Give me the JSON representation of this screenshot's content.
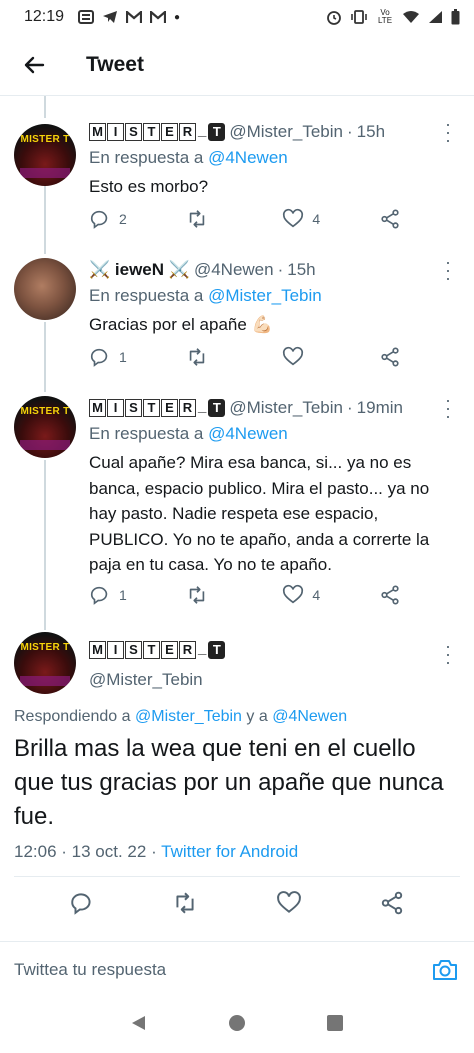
{
  "status_bar": {
    "time": "12:19",
    "left_icons": [
      "notes-icon",
      "telegram-icon",
      "gmail-icon",
      "gmail-icon",
      "dot-icon"
    ],
    "right_icons": [
      "alarm-icon",
      "vibrate-icon",
      "volte-icon",
      "wifi-icon",
      "signal-icon",
      "battery-icon"
    ],
    "volte_label": "Vo LTE"
  },
  "header": {
    "title": "Tweet"
  },
  "tweets": [
    {
      "name_letters": [
        "M",
        "I",
        "S",
        "T",
        "E",
        "R"
      ],
      "name_underscore": "_",
      "name_t": "T",
      "handle": "@Mister_Tebin",
      "time_ago": "15h",
      "reply_prefix": "En respuesta a",
      "reply_to": "@4Newen",
      "text": "Esto es morbo?",
      "replies": "2",
      "retweets": "",
      "likes": "4",
      "avatar_text": "MISTER T"
    },
    {
      "name_prefix": "⚔️",
      "name": "ieweN",
      "name_suffix": "⚔️",
      "handle": "@4Newen",
      "time_ago": "15h",
      "reply_prefix": "En respuesta a",
      "reply_to": "@Mister_Tebin",
      "text": "Gracias por el apañe 💪🏻",
      "replies": "1",
      "retweets": "",
      "likes": ""
    },
    {
      "name_letters": [
        "M",
        "I",
        "S",
        "T",
        "E",
        "R"
      ],
      "name_underscore": "_",
      "name_t": "T",
      "handle": "@Mister_Tebin",
      "time_ago": "19min",
      "reply_prefix": "En respuesta a",
      "reply_to": "@4Newen",
      "text": "Cual apañe? Mira esa banca, si... ya no es banca, espacio publico. Mira el pasto... ya no hay pasto. Nadie respeta ese espacio, PUBLICO. Yo no te apaño, anda a correrte la paja en tu casa. Yo no te apaño.",
      "replies": "1",
      "retweets": "",
      "likes": "4",
      "avatar_text": "MISTER T"
    }
  ],
  "main_tweet": {
    "name_letters": [
      "M",
      "I",
      "S",
      "T",
      "E",
      "R"
    ],
    "name_underscore": "_",
    "name_t": "T",
    "handle": "@Mister_Tebin",
    "avatar_text": "MISTER T",
    "reply_prefix": "Respondiendo a",
    "reply_to_1": "@Mister_Tebin",
    "reply_joiner": "y a",
    "reply_to_2": "@4Newen",
    "text": "Brilla mas la wea que teni en el cuello que tus gracias por un apañe que nunca fue.",
    "time": "12:06",
    "date": "13 oct. 22",
    "source": "Twitter for Android"
  },
  "reply_bar": {
    "placeholder": "Twittea tu respuesta"
  },
  "colors": {
    "link": "#1d9bf0",
    "muted": "#536471",
    "divider": "#e6ecf0"
  }
}
